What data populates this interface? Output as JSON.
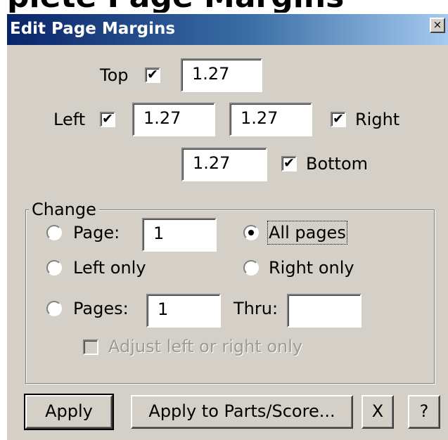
{
  "cut_title": "plete Page Margins",
  "window": {
    "title": "Edit Page Margins",
    "close_glyph": "×"
  },
  "margins": {
    "top": {
      "label": "Top",
      "checked": true,
      "value": "1.27"
    },
    "left": {
      "label": "Left",
      "checked": true,
      "value": "1.27"
    },
    "right": {
      "label": "Right",
      "checked": true,
      "value": "1.27"
    },
    "bottom": {
      "label": "Bottom",
      "checked": true,
      "value": "1.27"
    }
  },
  "change": {
    "legend": "Change",
    "page_label": "Page:",
    "page_value": "1",
    "all_pages_label": "All pages",
    "left_only_label": "Left only",
    "right_only_label": "Right only",
    "pages_label": "Pages:",
    "pages_from_value": "1",
    "thru_label": "Thru:",
    "thru_value": "",
    "selected": "All pages",
    "adjust_label": "Adjust left or right only"
  },
  "buttons": {
    "apply": "Apply",
    "apply_parts": "Apply to Parts/Score...",
    "x": "X",
    "help": "?"
  },
  "check_glyph": "✔"
}
